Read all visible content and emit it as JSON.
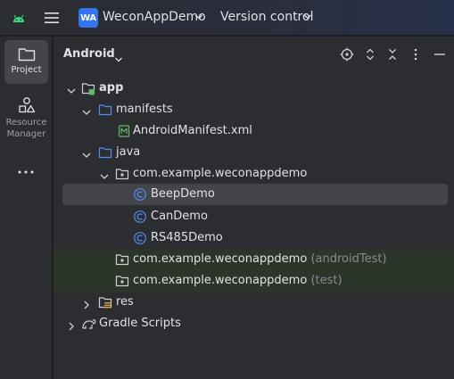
{
  "titlebar": {
    "project_badge": "WA",
    "project_name": "WeconAppDemo",
    "version_control": "Version control"
  },
  "toolstrip": {
    "project_label": "Project",
    "resource_manager_label_1": "Resource",
    "resource_manager_label_2": "Manager"
  },
  "panel": {
    "view_name": "Android"
  },
  "tree": {
    "app": "app",
    "manifests": "manifests",
    "android_manifest": "AndroidManifest.xml",
    "java": "java",
    "package_main": "com.example.weconappdemo",
    "beep_demo": "BeepDemo",
    "can_demo": "CanDemo",
    "rs485_demo": "RS485Demo",
    "package_android_test": "com.example.weconappdemo",
    "android_test_suffix": "(androidTest)",
    "package_test": "com.example.weconappdemo",
    "test_suffix": "(test)",
    "res": "res",
    "gradle_scripts": "Gradle Scripts"
  },
  "colors": {
    "accent": "#3574f0",
    "selection": "#43454a",
    "test_row_bg": "#2c3529",
    "android_green": "#3ddc84",
    "class_icon": "#548af7",
    "folder_blue": "#548af7",
    "manifest_green": "#5fb865"
  }
}
